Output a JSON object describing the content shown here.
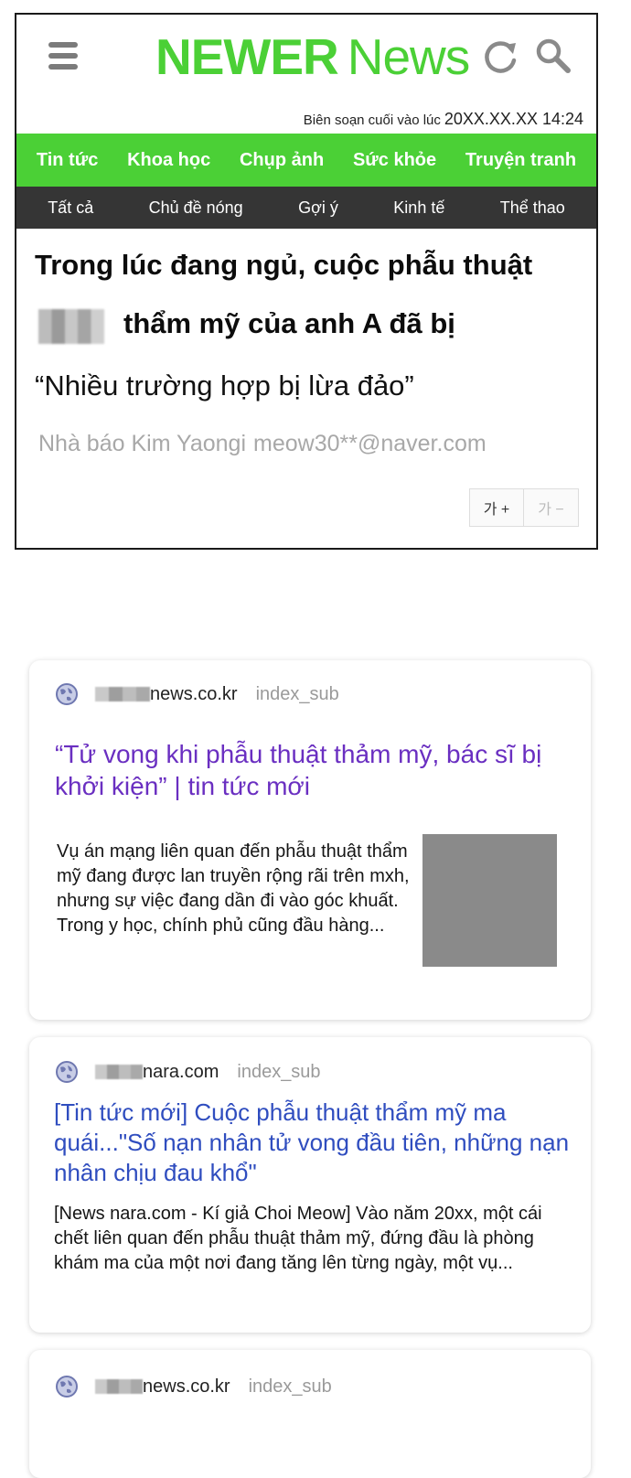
{
  "app": {
    "logo_bold": "NEWER",
    "logo_light": "News",
    "edited_label": "Biên soạn cuối vào lúc",
    "edited_time": "20XX.XX.XX  14:24",
    "main_nav": [
      "Tin tức",
      "Khoa học",
      "Chụp ảnh",
      "Sức khỏe",
      "Truyện tranh"
    ],
    "sub_nav": [
      "Tất cả",
      "Chủ đề nóng",
      "Gợi ý",
      "Kinh tế",
      "Thể thao"
    ],
    "headline_line1": "Trong lúc đang ngủ, cuộc phẫu thuật",
    "headline_line2": "thẩm mỹ của anh A đã bị",
    "subheadline": "“Nhiều trường hợp bị lừa đảo”",
    "byline_name": "Nhà báo Kim Yaongi",
    "byline_email": "meow30**@naver.com",
    "font_increase": "가 +",
    "font_decrease": "가 −",
    "brand_green": "#4bd036",
    "nav_dark": "#353535"
  },
  "results": [
    {
      "domain": "news.co.kr",
      "subpath": "index_sub",
      "title": "“Tử vong khi phẫu thuật thảm mỹ, bác sĩ bị khởi kiện” | tin tức mới",
      "snippet": "Vụ án mạng liên quan đến phẫu thuật thẩm mỹ đang được lan truyền rộng rãi trên mxh, nhưng sự việc đang dần đi vào góc khuất. Trong y học, chính phủ cũng đầu hàng...",
      "title_color": "#6a2fc1"
    },
    {
      "domain": "nara.com",
      "subpath": "index_sub",
      "title": "[Tin tức mới] Cuộc phẫu thuật thẩm mỹ ma quái...\"Số nạn nhân tử vong đầu tiên, những nạn nhân chịu đau khổ\"",
      "snippet": "[News nara.com - Kí giả Choi Meow] Vào năm 20xx, một cái chết liên quan đến phẫu thuật thảm mỹ, đứng đầu là phòng khám ma của một nơi đang tăng lên từng ngày, một vụ...",
      "title_color": "#2f4dbf"
    },
    {
      "domain": "news.co.kr",
      "subpath": "index_sub"
    }
  ],
  "icons": {
    "menu": "hamburger-icon",
    "refresh": "refresh-icon",
    "search": "search-icon",
    "site": "globe-icon"
  }
}
